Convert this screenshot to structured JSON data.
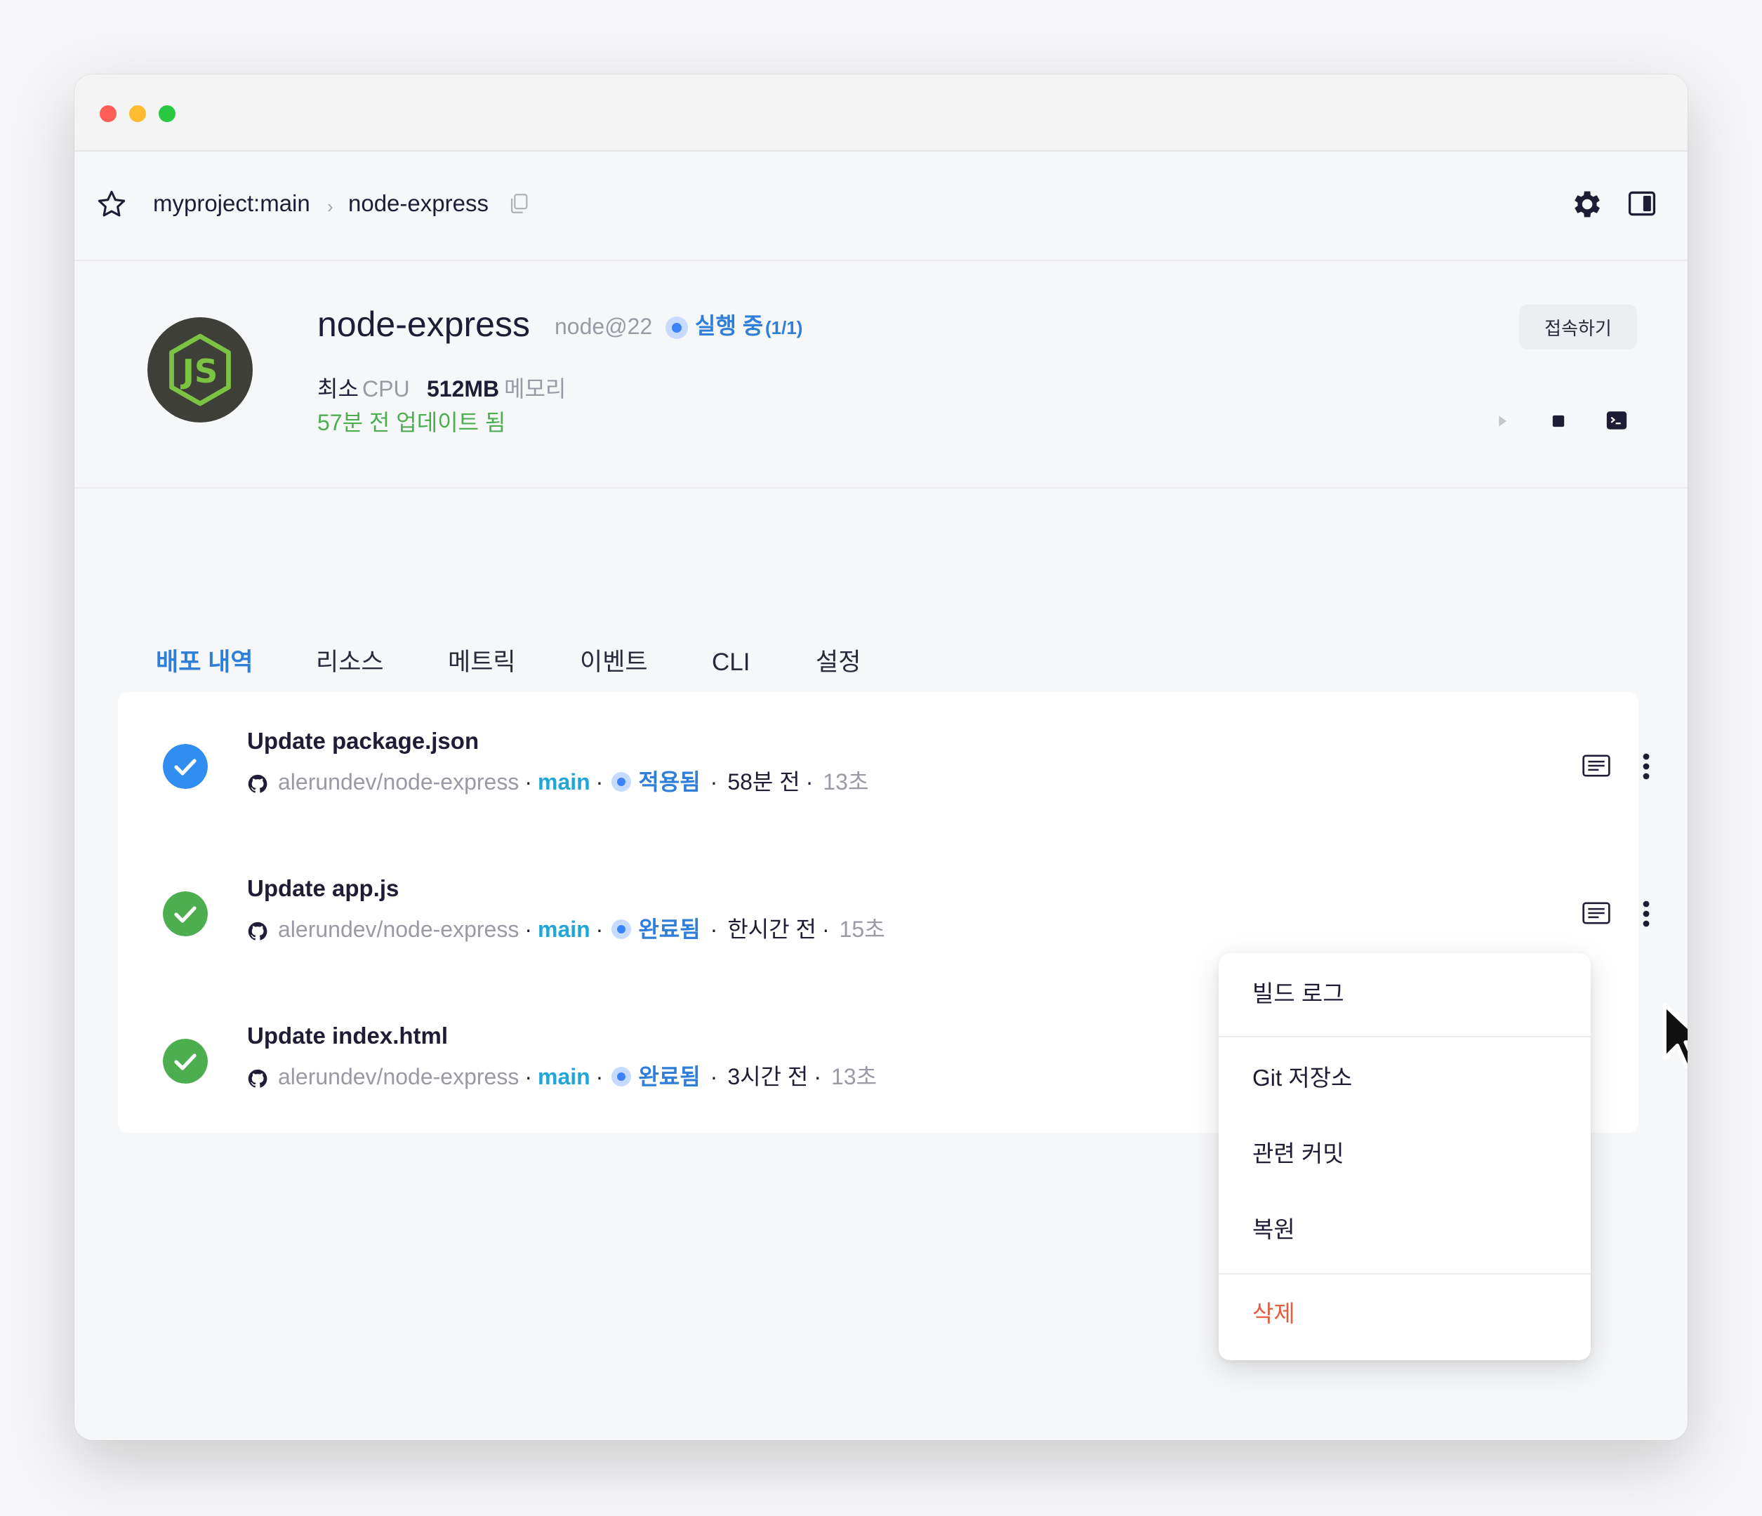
{
  "breadcrumb": {
    "project": "myproject:main",
    "separator": "›",
    "service": "node-express"
  },
  "service": {
    "name": "node-express",
    "runtime": "node@22",
    "status": "실행 중",
    "status_count": "(1/1)",
    "cpu_key": "최소",
    "cpu_val": "CPU",
    "memory_key": "512MB",
    "memory_val": "메모리",
    "updated": "57분 전 업데이트 됨",
    "connect_label": "접속하기"
  },
  "tabs": [
    {
      "label": "배포 내역",
      "active": true
    },
    {
      "label": "리소스"
    },
    {
      "label": "메트릭"
    },
    {
      "label": "이벤트"
    },
    {
      "label": "CLI"
    },
    {
      "label": "설정"
    }
  ],
  "deployments": [
    {
      "title": "Update package.json",
      "repo": "alerundev/node-express",
      "branch": "main",
      "status": "적용됨",
      "time": "58분 전",
      "duration": "13초",
      "check_color": "#2f8ef0"
    },
    {
      "title": "Update app.js",
      "repo": "alerundev/node-express",
      "branch": "main",
      "status": "완료됨",
      "time": "한시간 전",
      "duration": "15초",
      "check_color": "#4cae4f"
    },
    {
      "title": "Update index.html",
      "repo": "alerundev/node-express",
      "branch": "main",
      "status": "완료됨",
      "time": "3시간 전",
      "duration": "13초",
      "check_color": "#4cae4f"
    }
  ],
  "menu": {
    "items": [
      "빌드 로그",
      "Git 저장소",
      "관련 커밋",
      "복원",
      "삭제"
    ]
  },
  "colors": {
    "accent": "#2f7ed8",
    "success": "#4cae4f",
    "danger": "#e35d43",
    "logo_bg": "#3f3f3a",
    "logo_fg": "#7cc243"
  },
  "icons": [
    "star-icon",
    "copy-icon",
    "gear-icon",
    "panel-icon",
    "play-icon",
    "stop-icon",
    "terminal-icon",
    "github-icon",
    "log-icon",
    "more-icon",
    "check-icon",
    "cursor-icon"
  ]
}
